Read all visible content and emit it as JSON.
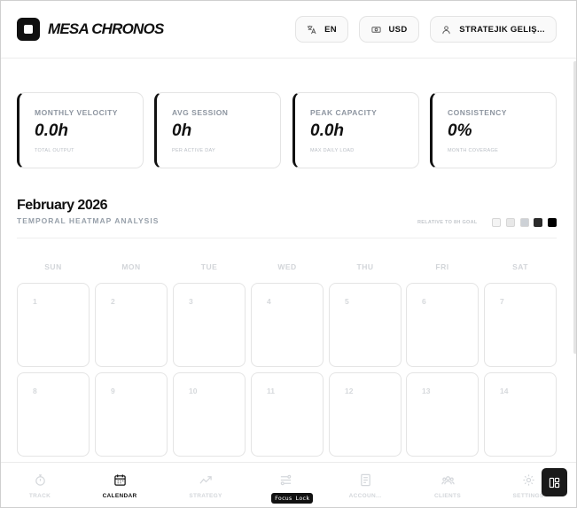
{
  "brand": "MESA CHRONOS",
  "header": {
    "language": "EN",
    "currency": "USD",
    "user": "STRATEJIK GELIŞ..."
  },
  "stats": [
    {
      "label": "MONTHLY VELOCITY",
      "value": "0.0h",
      "sub": "TOTAL OUTPUT"
    },
    {
      "label": "AVG SESSION",
      "value": "0h",
      "sub": "PER ACTIVE DAY"
    },
    {
      "label": "PEAK CAPACITY",
      "value": "0.0h",
      "sub": "MAX DAILY LOAD"
    },
    {
      "label": "CONSISTENCY",
      "value": "0%",
      "sub": "MONTH COVERAGE"
    }
  ],
  "calendar": {
    "title": "February 2026",
    "subtitle": "TEMPORAL HEATMAP ANALYSIS",
    "legend_label": "RELATIVE TO 8H GOAL",
    "legend_colors": [
      "#f4f4f4",
      "#e8e8e8",
      "#cdd1d6",
      "#2b2b2b",
      "#000000"
    ],
    "weekdays": [
      "SUN",
      "MON",
      "TUE",
      "WED",
      "THU",
      "FRI",
      "SAT"
    ],
    "days": [
      "1",
      "2",
      "3",
      "4",
      "5",
      "6",
      "7",
      "8",
      "9",
      "10",
      "11",
      "12",
      "13",
      "14"
    ]
  },
  "nav": {
    "items": [
      {
        "label": "TRACK",
        "icon": "stopwatch-icon",
        "active": false
      },
      {
        "label": "CALENDAR",
        "icon": "calendar-icon",
        "active": true
      },
      {
        "label": "STRATEGY",
        "icon": "trend-icon",
        "active": false
      },
      {
        "label": "Focus Lock",
        "icon": "focus-icon",
        "active": false
      },
      {
        "label": "ACCOUN...",
        "icon": "ledger-icon",
        "active": false
      },
      {
        "label": "CLIENTS",
        "icon": "users-icon",
        "active": false
      },
      {
        "label": "SETTINGS",
        "icon": "gear-icon",
        "active": false
      }
    ],
    "tooltip": "Focus Lock"
  },
  "colors": {
    "accent": "#111111",
    "muted": "#8d95a0",
    "border": "#e4e4e4"
  }
}
